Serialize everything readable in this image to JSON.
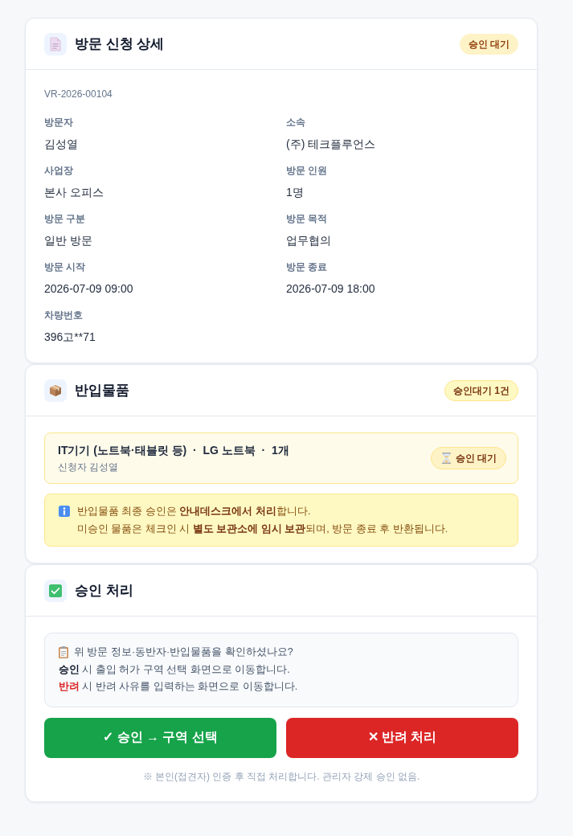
{
  "detail": {
    "title": "방문 신청 상세",
    "badge": "승인 대기",
    "request_id": "VR-2026-00104",
    "fields": [
      {
        "label": "방문자",
        "value": "김성열"
      },
      {
        "label": "소속",
        "value": "(주) 테크플루언스"
      },
      {
        "label": "사업장",
        "value": "본사 오피스"
      },
      {
        "label": "방문 인원",
        "value": "1명"
      },
      {
        "label": "방문 구분",
        "value": "일반 방문"
      },
      {
        "label": "방문 목적",
        "value": "업무협의"
      },
      {
        "label": "방문 시작",
        "value": "2026-07-09 09:00"
      },
      {
        "label": "방문 종료",
        "value": "2026-07-09 18:00"
      },
      {
        "label": "차량번호",
        "value": "396고**71"
      }
    ]
  },
  "items_section": {
    "title": "반입물품",
    "badge": "승인대기 1건",
    "items": [
      {
        "description": "IT기기 (노트북·태블릿 등)  ·  LG 노트북  ·  1개",
        "requester": "신청자 김성열",
        "status": "승인 대기"
      }
    ],
    "notice": [
      "반입물품 최종 승인은 **안내데스크에서 처리**합니다.",
      "미승인 물품은 체크인 시 **별도 보관소에 임시 보관**되며, 방문 종료 후 반환됩니다."
    ]
  },
  "approval": {
    "title": "승인 처리",
    "guide": [
      {
        "kind": "question",
        "text": "위 방문 정보·동반자·반입물품을 확인하셨나요?"
      },
      {
        "kind": "approve",
        "term": "승인",
        "text": "시 출입 허가 구역 선택 화면으로 이동합니다."
      },
      {
        "kind": "reject",
        "term": "반려",
        "text": "시 반려 사유를 입력하는 화면으로 이동합니다."
      }
    ],
    "buttons": [
      {
        "kind": "approve",
        "label": "✓ 승인 → 구역 선택"
      },
      {
        "kind": "reject",
        "label": "✕ 반려 처리"
      }
    ],
    "footnote": "※ 본인(접견자) 인증 후 직접 처리합니다. 관리자 강제 승인 없음."
  }
}
